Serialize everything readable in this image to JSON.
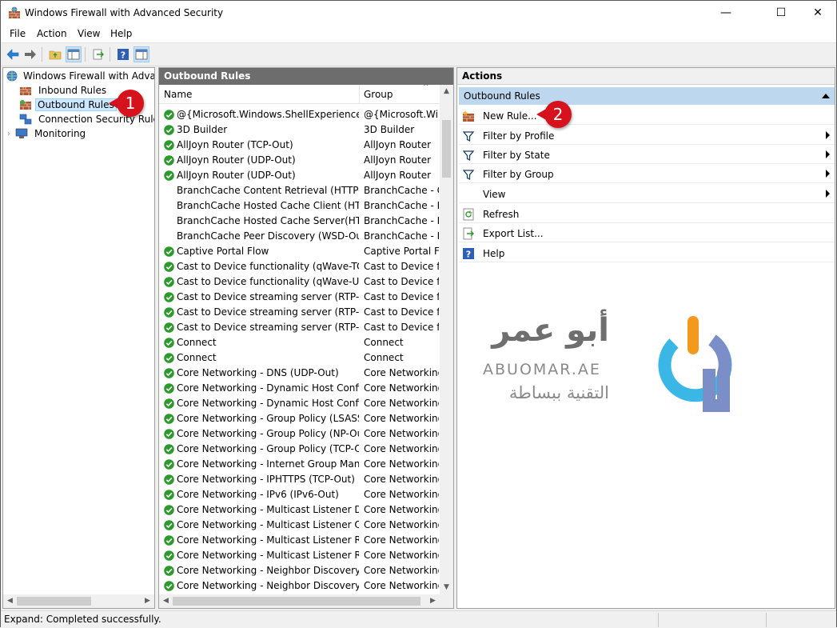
{
  "window": {
    "title": "Windows Firewall with Advanced Security",
    "controls": {
      "minimize": "—",
      "maximize": "☐",
      "close": "✕"
    }
  },
  "menu": [
    "File",
    "Action",
    "View",
    "Help"
  ],
  "tree": {
    "root": "Windows Firewall with Advance",
    "items": [
      {
        "label": "Inbound Rules",
        "selected": false
      },
      {
        "label": "Outbound Rules",
        "selected": true
      },
      {
        "label": "Connection Security Rules",
        "selected": false
      },
      {
        "label": "Monitoring",
        "selected": false
      }
    ]
  },
  "rules_pane": {
    "header": "Outbound Rules",
    "columns": {
      "name": "Name",
      "group": "Group"
    },
    "rows": [
      {
        "name": "@{Microsoft.Windows.ShellExperienceH...",
        "group": "@{Microsoft.Wind",
        "enabled": true
      },
      {
        "name": "3D Builder",
        "group": "3D Builder",
        "enabled": true
      },
      {
        "name": "AllJoyn Router (TCP-Out)",
        "group": "AllJoyn Router",
        "enabled": true
      },
      {
        "name": "AllJoyn Router (UDP-Out)",
        "group": "AllJoyn Router",
        "enabled": true
      },
      {
        "name": "AllJoyn Router (UDP-Out)",
        "group": "AllJoyn Router",
        "enabled": true
      },
      {
        "name": "BranchCache Content Retrieval (HTTP-O...",
        "group": "BranchCache - Co",
        "enabled": false
      },
      {
        "name": "BranchCache Hosted Cache Client (HTT...",
        "group": "BranchCache - Ho",
        "enabled": false
      },
      {
        "name": "BranchCache Hosted Cache Server(HTTP...",
        "group": "BranchCache - Ho",
        "enabled": false
      },
      {
        "name": "BranchCache Peer Discovery (WSD-Out)",
        "group": "BranchCache - Pe",
        "enabled": false
      },
      {
        "name": "Captive Portal Flow",
        "group": "Captive Portal Flo",
        "enabled": true
      },
      {
        "name": "Cast to Device functionality (qWave-TCP...",
        "group": "Cast to Device fun",
        "enabled": true
      },
      {
        "name": "Cast to Device functionality (qWave-UDP...",
        "group": "Cast to Device fun",
        "enabled": true
      },
      {
        "name": "Cast to Device streaming server (RTP-Stre...",
        "group": "Cast to Device fun",
        "enabled": true
      },
      {
        "name": "Cast to Device streaming server (RTP-Stre...",
        "group": "Cast to Device fun",
        "enabled": true
      },
      {
        "name": "Cast to Device streaming server (RTP-Stre...",
        "group": "Cast to Device fun",
        "enabled": true
      },
      {
        "name": "Connect",
        "group": "Connect",
        "enabled": true
      },
      {
        "name": "Connect",
        "group": "Connect",
        "enabled": true
      },
      {
        "name": "Core Networking - DNS (UDP-Out)",
        "group": "Core Networking",
        "enabled": true
      },
      {
        "name": "Core Networking - Dynamic Host Config...",
        "group": "Core Networking",
        "enabled": true
      },
      {
        "name": "Core Networking - Dynamic Host Config...",
        "group": "Core Networking",
        "enabled": true
      },
      {
        "name": "Core Networking - Group Policy (LSASS-...",
        "group": "Core Networking",
        "enabled": true
      },
      {
        "name": "Core Networking - Group Policy (NP-Out)",
        "group": "Core Networking",
        "enabled": true
      },
      {
        "name": "Core Networking - Group Policy (TCP-Out)",
        "group": "Core Networking",
        "enabled": true
      },
      {
        "name": "Core Networking - Internet Group Mana...",
        "group": "Core Networking",
        "enabled": true
      },
      {
        "name": "Core Networking - IPHTTPS (TCP-Out)",
        "group": "Core Networking",
        "enabled": true
      },
      {
        "name": "Core Networking - IPv6 (IPv6-Out)",
        "group": "Core Networking",
        "enabled": true
      },
      {
        "name": "Core Networking - Multicast Listener Do...",
        "group": "Core Networking",
        "enabled": true
      },
      {
        "name": "Core Networking - Multicast Listener Qu...",
        "group": "Core Networking",
        "enabled": true
      },
      {
        "name": "Core Networking - Multicast Listener Rep...",
        "group": "Core Networking",
        "enabled": true
      },
      {
        "name": "Core Networking - Multicast Listener Rep...",
        "group": "Core Networking",
        "enabled": true
      },
      {
        "name": "Core Networking - Neighbor Discovery A...",
        "group": "Core Networking",
        "enabled": true
      },
      {
        "name": "Core Networking - Neighbor Discovery S...",
        "group": "Core Networking",
        "enabled": true
      }
    ]
  },
  "actions_pane": {
    "header": "Actions",
    "section": "Outbound Rules",
    "items": [
      {
        "label": "New Rule...",
        "icon": "new-rule-icon",
        "submenu": false
      },
      {
        "label": "Filter by Profile",
        "icon": "filter-icon",
        "submenu": true
      },
      {
        "label": "Filter by State",
        "icon": "filter-icon",
        "submenu": true
      },
      {
        "label": "Filter by Group",
        "icon": "filter-icon",
        "submenu": true
      },
      {
        "label": "View",
        "icon": "",
        "submenu": true
      },
      {
        "label": "Refresh",
        "icon": "refresh-icon",
        "submenu": false
      },
      {
        "label": "Export List...",
        "icon": "export-icon",
        "submenu": false
      },
      {
        "label": "Help",
        "icon": "help-icon",
        "submenu": false
      }
    ]
  },
  "callouts": [
    "1",
    "2"
  ],
  "watermark": {
    "arabic": "أبو عمر",
    "latin": "ABUOMAR.AE",
    "tagline": "التقنية ببساطة"
  },
  "status": {
    "text": "Expand:  Completed successfully."
  },
  "colors": {
    "accent_section": "#bcd7ee",
    "callout": "#d6121d",
    "check": "#2e9a2e",
    "logo_orange": "#f39a1e",
    "logo_blue": "#3bb7e6",
    "logo_purple": "#7b8ec8"
  }
}
